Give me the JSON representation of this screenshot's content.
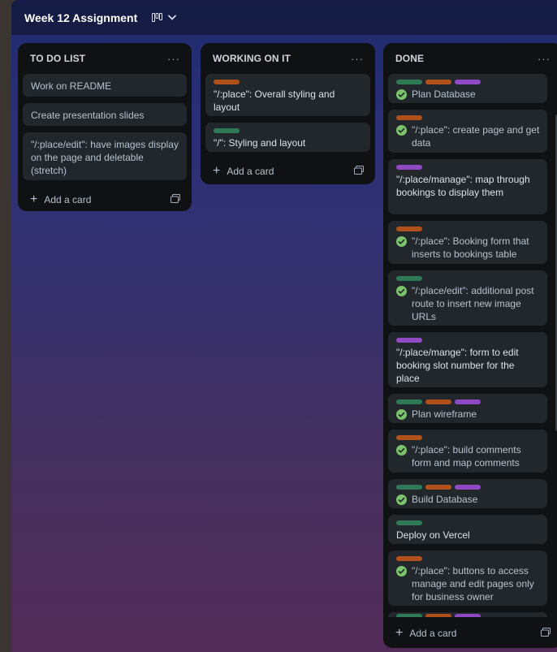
{
  "board": {
    "title": "Week 12 Assignment",
    "view_icon": "board-view-icon"
  },
  "lists": {
    "todo": {
      "title": "TO DO LIST",
      "menu": "···",
      "cards": [
        "Work on README",
        "Create presentation slides",
        "\"/:place/edit\": have images display on the page and deletable (stretch)"
      ],
      "add_label": "Add a card"
    },
    "working": {
      "title": "WORKING ON IT",
      "menu": "···",
      "cards": [
        "\"/:place\": Overall styling and layout",
        "\"/\": Styling and layout"
      ],
      "add_label": "Add a card"
    },
    "done": {
      "title": "DONE",
      "menu": "···",
      "cards": [
        "Plan Database",
        "\"/:place\": create page and get data",
        "\"/:place/manage\": map through bookings to display them",
        "\"/:place\": Booking form that inserts to bookings table",
        "\"/:place/edit\": additional post route to insert new image URLs",
        "\"/:place/mange\": form to edit booking slot number for the place",
        "Plan wireframe",
        "\"/:place\": build comments form and map comments",
        "Build Database",
        "Deploy on Vercel",
        "\"/:place\": buttons to access manage and edit pages only for business owner"
      ],
      "add_label": "Add a card"
    }
  },
  "colors": {
    "label_green": "#2e7a57",
    "label_orange": "#b0501a",
    "label_purple": "#8f49c4",
    "check_green": "#7cc36d"
  }
}
